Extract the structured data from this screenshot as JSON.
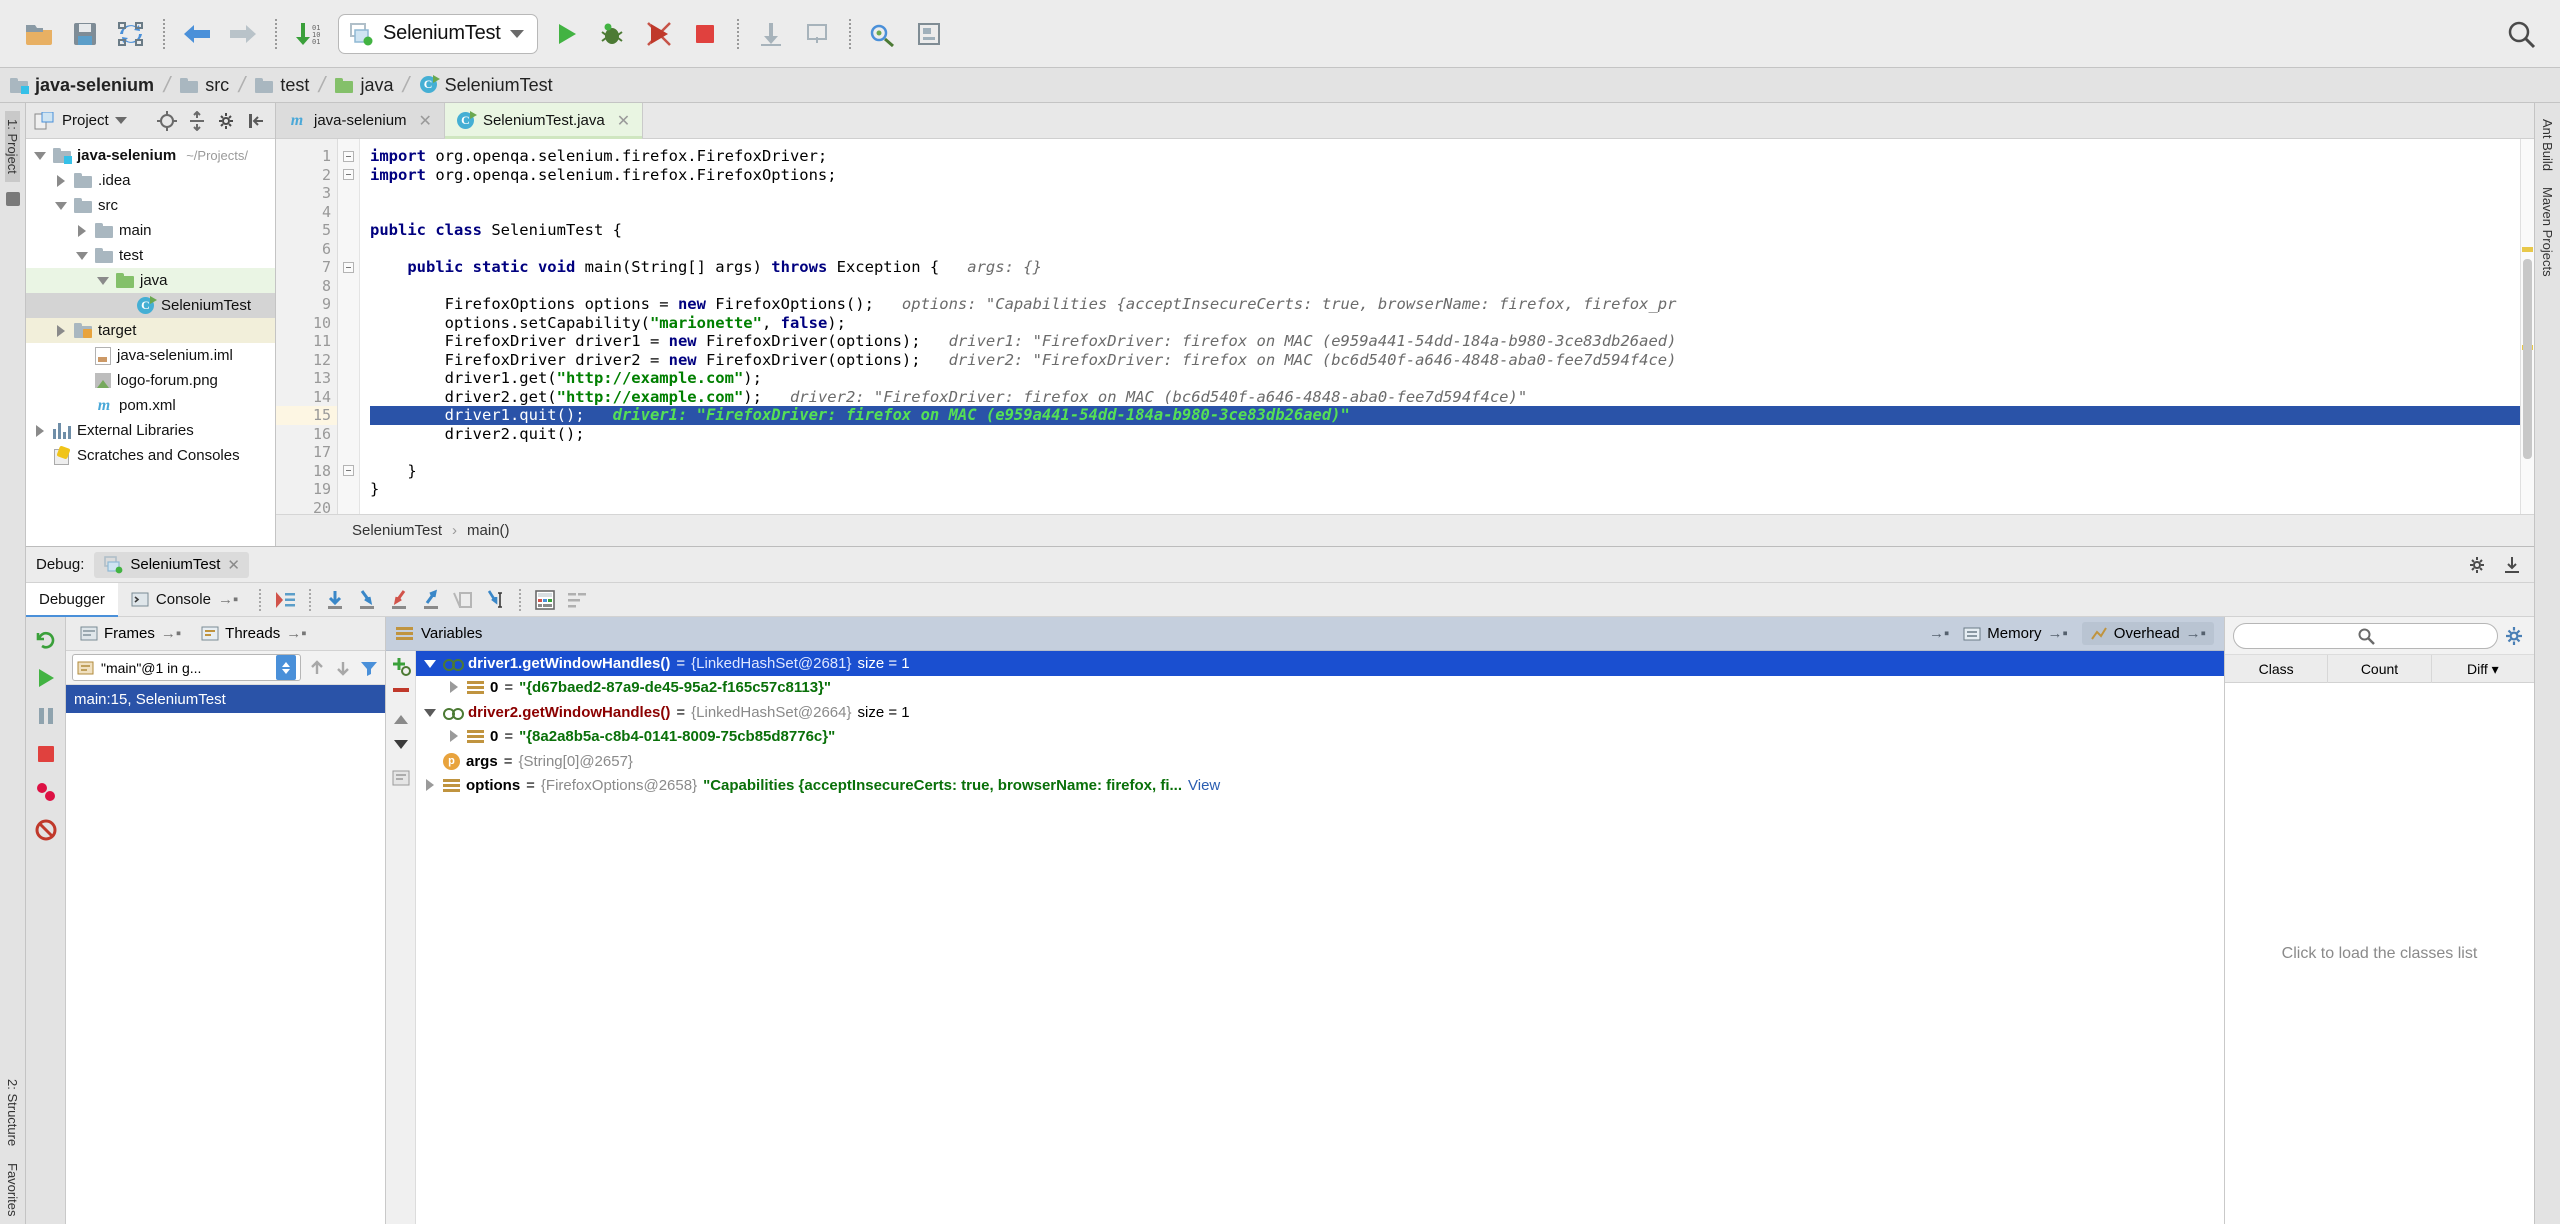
{
  "toolbar": {
    "icons": [
      {
        "name": "open-folder-icon",
        "label": "Open"
      },
      {
        "name": "save-all-icon",
        "label": "Save All"
      },
      {
        "name": "sync-refresh-icon",
        "label": "Synchronize"
      },
      {
        "name": "back-arrow-icon",
        "label": "Back"
      },
      {
        "name": "forward-arrow-icon",
        "label": "Forward"
      },
      {
        "name": "compile-icon",
        "label": "Build"
      }
    ],
    "run_config": {
      "name": "SeleniumTest",
      "icon": "run-config-icon"
    },
    "run_label": "Run",
    "debug_label": "Debug",
    "coverage_label": "Run with Coverage",
    "stop_label": "Stop",
    "update_label": "Update Application",
    "profile_label": "Profiler",
    "search_label": "Search Everywhere"
  },
  "breadcrumb": {
    "items": [
      {
        "label": "java-selenium",
        "icon": "module-folder-icon"
      },
      {
        "label": "src",
        "icon": "folder-icon"
      },
      {
        "label": "test",
        "icon": "folder-icon"
      },
      {
        "label": "java",
        "icon": "source-folder-icon"
      },
      {
        "label": "SeleniumTest",
        "icon": "class-icon"
      }
    ]
  },
  "left_rail": {
    "items": [
      "1: Project",
      "2: Structure",
      "Favorites"
    ]
  },
  "right_rail": {
    "items": [
      "Ant Build",
      "Maven Projects"
    ]
  },
  "project_panel": {
    "title": "Project",
    "icons": [
      "locate-icon",
      "collapse-all-icon",
      "settings-gear-icon",
      "hide-panel-icon"
    ],
    "tree": [
      {
        "label": "java-selenium",
        "path": "~/Projects/",
        "indent": 0,
        "twisty": "open",
        "icon": "module-folder-icon",
        "bold": true,
        "highlight": "none"
      },
      {
        "label": ".idea",
        "path": "",
        "indent": 1,
        "twisty": "closed",
        "icon": "folder-icon",
        "bold": false,
        "highlight": "none"
      },
      {
        "label": "src",
        "path": "",
        "indent": 1,
        "twisty": "open",
        "icon": "folder-icon",
        "bold": false,
        "highlight": "none"
      },
      {
        "label": "main",
        "path": "",
        "indent": 2,
        "twisty": "closed",
        "icon": "folder-icon",
        "bold": false,
        "highlight": "none"
      },
      {
        "label": "test",
        "path": "",
        "indent": 2,
        "twisty": "open",
        "icon": "folder-icon",
        "bold": false,
        "highlight": "none"
      },
      {
        "label": "java",
        "path": "",
        "indent": 3,
        "twisty": "open",
        "icon": "source-folder-icon",
        "bold": false,
        "highlight": "green"
      },
      {
        "label": "SeleniumTest",
        "path": "",
        "indent": 4,
        "twisty": "none",
        "icon": "class-icon",
        "bold": false,
        "highlight": "gray"
      },
      {
        "label": "target",
        "path": "",
        "indent": 1,
        "twisty": "closed",
        "icon": "target-folder-icon",
        "bold": false,
        "highlight": "yellowish"
      },
      {
        "label": "java-selenium.iml",
        "path": "",
        "indent": 2,
        "twisty": "none",
        "icon": "iml-file-icon",
        "bold": false,
        "highlight": "none"
      },
      {
        "label": "logo-forum.png",
        "path": "",
        "indent": 2,
        "twisty": "none",
        "icon": "png-file-icon",
        "bold": false,
        "highlight": "none"
      },
      {
        "label": "pom.xml",
        "path": "",
        "indent": 2,
        "twisty": "none",
        "icon": "maven-icon",
        "bold": false,
        "highlight": "none"
      },
      {
        "label": "External Libraries",
        "path": "",
        "indent": 0,
        "twisty": "closed",
        "icon": "libraries-icon",
        "bold": false,
        "highlight": "none"
      },
      {
        "label": "Scratches and Consoles",
        "path": "",
        "indent": 0,
        "twisty": "none",
        "icon": "scratches-icon",
        "bold": false,
        "highlight": "none"
      }
    ]
  },
  "editor": {
    "tabs": [
      {
        "label": "java-selenium",
        "icon": "maven-icon",
        "active": false
      },
      {
        "label": "SeleniumTest.java",
        "icon": "class-icon",
        "active": true
      }
    ],
    "lines": [
      {
        "n": 1,
        "fold": "minus",
        "run": false,
        "bp": false,
        "current": false,
        "segs": [
          {
            "t": "import",
            "c": "kw"
          },
          {
            "t": " org.openqa.selenium.firefox.FirefoxDriver;",
            "c": ""
          }
        ]
      },
      {
        "n": 2,
        "fold": "minus",
        "run": false,
        "bp": false,
        "current": false,
        "segs": [
          {
            "t": "import",
            "c": "kw"
          },
          {
            "t": " org.openqa.selenium.firefox.FirefoxOptions;",
            "c": ""
          }
        ]
      },
      {
        "n": 3,
        "fold": "",
        "run": false,
        "bp": false,
        "current": false,
        "segs": []
      },
      {
        "n": 4,
        "fold": "",
        "run": false,
        "bp": false,
        "current": false,
        "segs": []
      },
      {
        "n": 5,
        "fold": "",
        "run": true,
        "bp": false,
        "current": false,
        "segs": [
          {
            "t": "public class",
            "c": "kw"
          },
          {
            "t": " SeleniumTest {",
            "c": ""
          }
        ]
      },
      {
        "n": 6,
        "fold": "",
        "run": false,
        "bp": false,
        "current": false,
        "segs": []
      },
      {
        "n": 7,
        "fold": "minus",
        "run": true,
        "bp": false,
        "current": false,
        "segs": [
          {
            "t": "    ",
            "c": ""
          },
          {
            "t": "public static void",
            "c": "kw"
          },
          {
            "t": " main(String[] args) ",
            "c": ""
          },
          {
            "t": "throws",
            "c": "kw"
          },
          {
            "t": " Exception {",
            "c": ""
          },
          {
            "t": "   args: {}",
            "c": "hint"
          }
        ]
      },
      {
        "n": 8,
        "fold": "",
        "run": false,
        "bp": false,
        "current": false,
        "segs": []
      },
      {
        "n": 9,
        "fold": "",
        "run": false,
        "bp": false,
        "current": false,
        "segs": [
          {
            "t": "        FirefoxOptions options = ",
            "c": ""
          },
          {
            "t": "new",
            "c": "kw"
          },
          {
            "t": " FirefoxOptions();",
            "c": ""
          },
          {
            "t": "   options: \"Capabilities {acceptInsecureCerts: true, browserName: firefox, firefox_pr",
            "c": "hint"
          }
        ]
      },
      {
        "n": 10,
        "fold": "",
        "run": false,
        "bp": false,
        "current": false,
        "segs": [
          {
            "t": "        options.setCapability(",
            "c": ""
          },
          {
            "t": "\"marionette\"",
            "c": "str"
          },
          {
            "t": ", ",
            "c": ""
          },
          {
            "t": "false",
            "c": "kw"
          },
          {
            "t": ");",
            "c": ""
          }
        ]
      },
      {
        "n": 11,
        "fold": "",
        "run": false,
        "bp": false,
        "current": false,
        "segs": [
          {
            "t": "        FirefoxDriver driver1 = ",
            "c": ""
          },
          {
            "t": "new",
            "c": "kw"
          },
          {
            "t": " FirefoxDriver(options);",
            "c": ""
          },
          {
            "t": "   driver1: \"FirefoxDriver: firefox on MAC (e959a441-54dd-184a-b980-3ce83db26aed)",
            "c": "hint"
          }
        ]
      },
      {
        "n": 12,
        "fold": "",
        "run": false,
        "bp": false,
        "current": false,
        "segs": [
          {
            "t": "        FirefoxDriver driver2 = ",
            "c": ""
          },
          {
            "t": "new",
            "c": "kw"
          },
          {
            "t": " FirefoxDriver(options);",
            "c": ""
          },
          {
            "t": "   driver2: \"FirefoxDriver: firefox on MAC (bc6d540f-a646-4848-aba0-fee7d594f4ce)",
            "c": "hint"
          }
        ]
      },
      {
        "n": 13,
        "fold": "",
        "run": false,
        "bp": false,
        "current": false,
        "segs": [
          {
            "t": "        driver1.get(",
            "c": ""
          },
          {
            "t": "\"http://example.com\"",
            "c": "str"
          },
          {
            "t": ");",
            "c": ""
          }
        ]
      },
      {
        "n": 14,
        "fold": "",
        "run": false,
        "bp": false,
        "current": false,
        "segs": [
          {
            "t": "        driver2.get(",
            "c": ""
          },
          {
            "t": "\"http://example.com\"",
            "c": "str"
          },
          {
            "t": ");",
            "c": ""
          },
          {
            "t": "   driver2: \"FirefoxDriver: firefox on MAC (bc6d540f-a646-4848-aba0-fee7d594f4ce)\"",
            "c": "hint"
          }
        ]
      },
      {
        "n": 15,
        "fold": "",
        "run": false,
        "bp": true,
        "current": true,
        "segs": [
          {
            "t": "        driver1.quit();",
            "c": ""
          },
          {
            "t": "   driver1: \"FirefoxDriver: firefox on MAC (e959a441-54dd-184a-b980-3ce83db26aed)\"",
            "c": "hint-g"
          }
        ]
      },
      {
        "n": 16,
        "fold": "",
        "run": false,
        "bp": false,
        "current": false,
        "segs": [
          {
            "t": "        driver2.quit();",
            "c": ""
          }
        ]
      },
      {
        "n": 17,
        "fold": "",
        "run": false,
        "bp": false,
        "current": false,
        "segs": []
      },
      {
        "n": 18,
        "fold": "minus",
        "run": false,
        "bp": false,
        "current": false,
        "segs": [
          {
            "t": "    }",
            "c": ""
          }
        ]
      },
      {
        "n": 19,
        "fold": "",
        "run": false,
        "bp": false,
        "current": false,
        "segs": [
          {
            "t": "}",
            "c": ""
          }
        ]
      },
      {
        "n": 20,
        "fold": "",
        "run": false,
        "bp": false,
        "current": false,
        "segs": []
      }
    ],
    "status_crumb": [
      "SeleniumTest",
      "main()"
    ]
  },
  "debug": {
    "label": "Debug:",
    "session": "SeleniumTest",
    "session_icon": "run-config-icon",
    "tabs": [
      {
        "label": "Debugger",
        "icon": "",
        "active": true
      },
      {
        "label": "Console",
        "icon": "console-icon",
        "active": false
      }
    ],
    "toolbar_icons": [
      {
        "name": "show-execution-point-icon"
      },
      {
        "name": "step-over-icon"
      },
      {
        "name": "step-into-icon"
      },
      {
        "name": "force-step-into-icon"
      },
      {
        "name": "step-out-icon"
      },
      {
        "name": "drop-frame-icon"
      },
      {
        "name": "run-to-cursor-icon"
      },
      {
        "name": "evaluate-expression-icon"
      },
      {
        "name": "threads-view-icon"
      }
    ],
    "rail_icons": [
      {
        "name": "rerun-icon"
      },
      {
        "name": "resume-program-icon"
      },
      {
        "name": "pause-program-icon"
      },
      {
        "name": "stop-icon"
      },
      {
        "name": "view-breakpoints-icon"
      },
      {
        "name": "mute-breakpoints-icon"
      }
    ],
    "settings_icon": "settings-gear-icon",
    "export_icon": "export-icon",
    "frames": {
      "frames_tab": "Frames",
      "threads_tab": "Threads",
      "thread_name": "\"main\"@1 in g...",
      "thread_icon": "thread-icon",
      "nav_icons": [
        "arrow-up-icon",
        "arrow-down-icon",
        "filter-icon"
      ],
      "items": [
        {
          "label": "main:15, SeleniumTest",
          "selected": true
        }
      ]
    },
    "variables": {
      "title": "Variables",
      "title_icon": "variables-icon",
      "side_icons": [
        "add-watch-icon",
        "remove-watch-icon",
        "scroll-up-icon",
        "scroll-down-icon"
      ],
      "memory_tab": "Memory",
      "overhead_tab": "Overhead",
      "rows": [
        {
          "indent": 0,
          "twisty": "open",
          "icon": "watch-icon",
          "selected": true,
          "name": "driver1.getWindowHandles()",
          "eq": " = ",
          "type": "{LinkedHashSet@2681}",
          "extra": "size = 1",
          "value": ""
        },
        {
          "indent": 1,
          "twisty": "closed",
          "icon": "list-icon",
          "selected": false,
          "name": "0",
          "eq": " = ",
          "type": "",
          "extra": "",
          "value": "\"{d67baed2-87a9-de45-95a2-f165c57c8113}\""
        },
        {
          "indent": 0,
          "twisty": "open",
          "icon": "watch-icon",
          "selected": false,
          "name": "driver2.getWindowHandles()",
          "eq": " = ",
          "type": "{LinkedHashSet@2664}",
          "extra": "size = 1",
          "value": ""
        },
        {
          "indent": 1,
          "twisty": "closed",
          "icon": "list-icon",
          "selected": false,
          "name": "0",
          "eq": " = ",
          "type": "",
          "extra": "",
          "value": "\"{8a2a8b5a-c8b4-0141-8009-75cb85d8776c}\""
        },
        {
          "indent": 0,
          "twisty": "none",
          "icon": "param-icon",
          "selected": false,
          "name": "args",
          "eq": " = ",
          "type": "{String[0]@2657}",
          "extra": "",
          "value": ""
        },
        {
          "indent": 0,
          "twisty": "closed",
          "icon": "list-icon",
          "selected": false,
          "name": "options",
          "eq": " = ",
          "type": "{FirefoxOptions@2658}",
          "extra": "",
          "value": "\"Capabilities {acceptInsecureCerts: true, browserName: firefox, fi...",
          "link": "View"
        }
      ]
    },
    "memory": {
      "search_placeholder": "",
      "search_icon": "search-icon",
      "settings_icon": "settings-gear-icon",
      "columns": [
        "Class",
        "Count",
        "Diff"
      ],
      "empty_text": "Click to load the classes list"
    }
  }
}
